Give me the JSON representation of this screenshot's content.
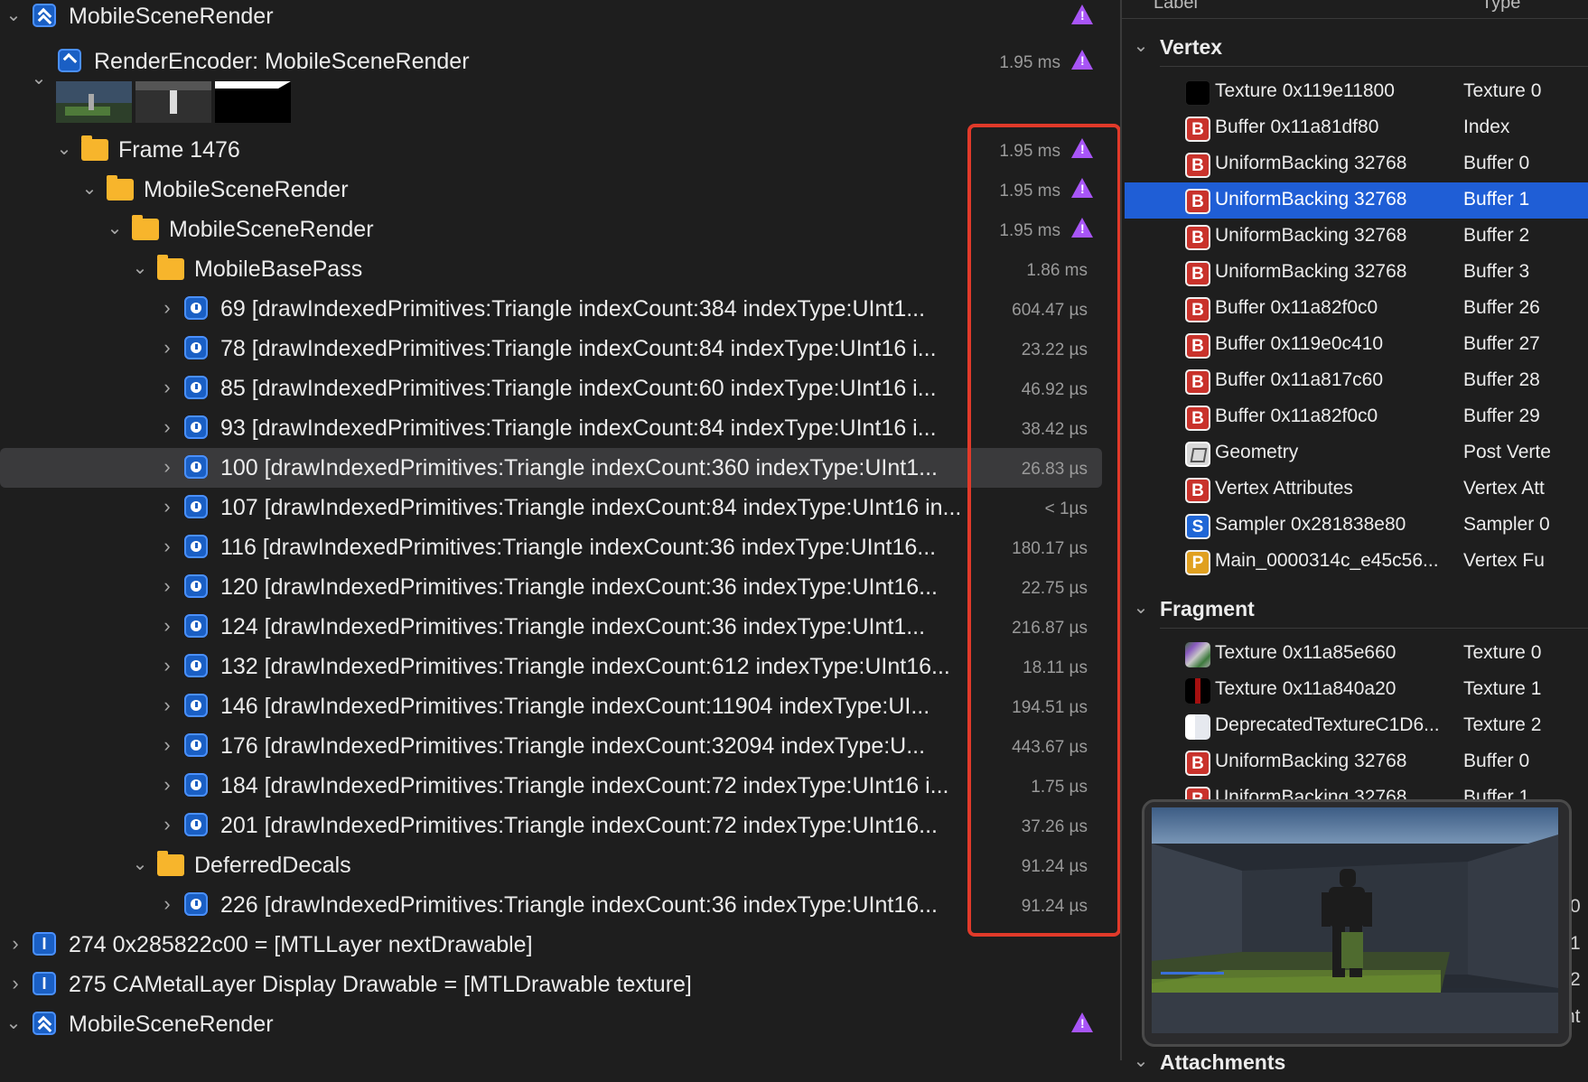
{
  "tree": {
    "root": {
      "label": "MobileSceneRender"
    },
    "encoder": {
      "label": "RenderEncoder: MobileSceneRender",
      "time": "1.95 ms"
    },
    "frame": {
      "label": "Frame 1476",
      "time": "1.95 ms"
    },
    "scene1": {
      "label": "MobileSceneRender",
      "time": "1.95 ms"
    },
    "scene2": {
      "label": "MobileSceneRender",
      "time": "1.95 ms"
    },
    "basepass": {
      "label": "MobileBasePass",
      "time": "1.86 ms"
    },
    "draws": [
      {
        "label": "69 [drawIndexedPrimitives:Triangle indexCount:384 indexType:UInt1...",
        "time": "604.47 µs"
      },
      {
        "label": "78 [drawIndexedPrimitives:Triangle indexCount:84 indexType:UInt16 i...",
        "time": "23.22 µs"
      },
      {
        "label": "85 [drawIndexedPrimitives:Triangle indexCount:60 indexType:UInt16 i...",
        "time": "46.92 µs"
      },
      {
        "label": "93 [drawIndexedPrimitives:Triangle indexCount:84 indexType:UInt16 i...",
        "time": "38.42 µs"
      },
      {
        "label": "100 [drawIndexedPrimitives:Triangle indexCount:360 indexType:UInt1...",
        "time": "26.83 µs"
      },
      {
        "label": "107 [drawIndexedPrimitives:Triangle indexCount:84 indexType:UInt16 in...",
        "time": "< 1µs"
      },
      {
        "label": "116 [drawIndexedPrimitives:Triangle indexCount:36 indexType:UInt16...",
        "time": "180.17 µs"
      },
      {
        "label": "120 [drawIndexedPrimitives:Triangle indexCount:36 indexType:UInt16...",
        "time": "22.75 µs"
      },
      {
        "label": "124 [drawIndexedPrimitives:Triangle indexCount:36 indexType:UInt1...",
        "time": "216.87 µs"
      },
      {
        "label": "132 [drawIndexedPrimitives:Triangle indexCount:612 indexType:UInt16...",
        "time": "18.11 µs"
      },
      {
        "label": "146 [drawIndexedPrimitives:Triangle indexCount:11904 indexType:UI...",
        "time": "194.51 µs"
      },
      {
        "label": "176 [drawIndexedPrimitives:Triangle indexCount:32094 indexType:U...",
        "time": "443.67 µs"
      },
      {
        "label": "184 [drawIndexedPrimitives:Triangle indexCount:72 indexType:UInt16 i...",
        "time": "1.75 µs"
      },
      {
        "label": "201 [drawIndexedPrimitives:Triangle indexCount:72 indexType:UInt16...",
        "time": "37.26 µs"
      }
    ],
    "decals": {
      "label": "DeferredDecals",
      "time": "91.24 µs"
    },
    "decal_draw": {
      "label": "226 [drawIndexedPrimitives:Triangle indexCount:36 indexType:UInt16...",
      "time": "91.24 µs"
    },
    "call274": {
      "label": "274 0x285822c00 = [MTLLayer nextDrawable]"
    },
    "call275": {
      "label": "275 CAMetalLayer Display Drawable = [MTLDrawable texture]"
    },
    "root2": {
      "label": "MobileSceneRender"
    }
  },
  "inspector": {
    "columns": {
      "label": "Label",
      "type": "Type"
    },
    "vertex": {
      "title": "Vertex",
      "items": [
        {
          "icon": "texture-black",
          "label": "Texture 0x119e11800",
          "type": "Texture 0"
        },
        {
          "icon": "B",
          "label": "Buffer 0x11a81df80",
          "type": "Index"
        },
        {
          "icon": "B",
          "label": "UniformBacking 32768",
          "type": "Buffer 0"
        },
        {
          "icon": "B",
          "label": "UniformBacking 32768",
          "type": "Buffer 1"
        },
        {
          "icon": "B",
          "label": "UniformBacking 32768",
          "type": "Buffer 2"
        },
        {
          "icon": "B",
          "label": "UniformBacking 32768",
          "type": "Buffer 3"
        },
        {
          "icon": "B",
          "label": "Buffer 0x11a82f0c0",
          "type": "Buffer 26"
        },
        {
          "icon": "B",
          "label": "Buffer 0x119e0c410",
          "type": "Buffer 27"
        },
        {
          "icon": "B",
          "label": "Buffer 0x11a817c60",
          "type": "Buffer 28"
        },
        {
          "icon": "B",
          "label": "Buffer 0x11a82f0c0",
          "type": "Buffer 29"
        },
        {
          "icon": "geometry",
          "label": "Geometry",
          "type": "Post Verte"
        },
        {
          "icon": "B",
          "label": "Vertex Attributes",
          "type": "Vertex Att"
        },
        {
          "icon": "S",
          "label": "Sampler 0x281838e80",
          "type": "Sampler 0"
        },
        {
          "icon": "P",
          "label": "Main_0000314c_e45c56...",
          "type": "Vertex Fu"
        }
      ]
    },
    "fragment": {
      "title": "Fragment",
      "items": [
        {
          "icon": "texture-noise",
          "label": "Texture 0x11a85e660",
          "type": "Texture 0"
        },
        {
          "icon": "texture-red",
          "label": "Texture 0x11a840a20",
          "type": "Texture 1"
        },
        {
          "icon": "texture-white",
          "label": "DeprecatedTextureC1D6...",
          "type": "Texture 2"
        },
        {
          "icon": "B",
          "label": "UniformBacking 32768",
          "type": "Buffer 0"
        },
        {
          "icon": "B",
          "label": "UniformBacking 32768",
          "type": "Buffer 1"
        }
      ]
    },
    "attachments_title": "Attachments",
    "partial_right": [
      "0",
      "1",
      "2",
      "nt"
    ]
  }
}
